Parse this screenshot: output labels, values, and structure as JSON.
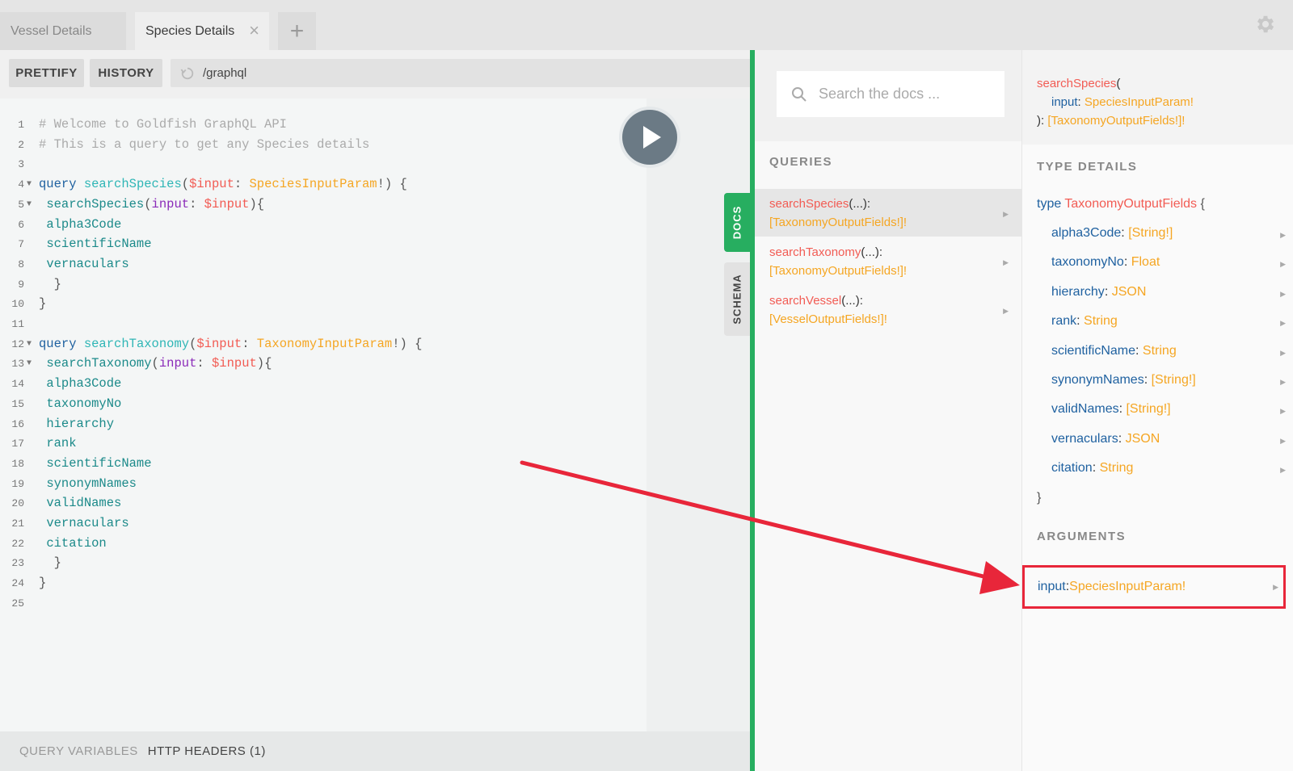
{
  "tabs": [
    {
      "label": "Vessel Details",
      "active": false
    },
    {
      "label": "Species Details",
      "active": true
    }
  ],
  "tab_close_glyph": "×",
  "tab_add_glyph": "+",
  "toolbar": {
    "prettify_label": "PRETTIFY",
    "history_label": "HISTORY",
    "endpoint": "/graphql"
  },
  "editor": {
    "lines": [
      {
        "n": "1",
        "fold": false
      },
      {
        "n": "2",
        "fold": false
      },
      {
        "n": "3",
        "fold": false
      },
      {
        "n": "4",
        "fold": true
      },
      {
        "n": "5",
        "fold": true
      },
      {
        "n": "6",
        "fold": false
      },
      {
        "n": "7",
        "fold": false
      },
      {
        "n": "8",
        "fold": false
      },
      {
        "n": "9",
        "fold": false
      },
      {
        "n": "10",
        "fold": false
      },
      {
        "n": "11",
        "fold": false
      },
      {
        "n": "12",
        "fold": true
      },
      {
        "n": "13",
        "fold": true
      },
      {
        "n": "14",
        "fold": false
      },
      {
        "n": "15",
        "fold": false
      },
      {
        "n": "16",
        "fold": false
      },
      {
        "n": "17",
        "fold": false
      },
      {
        "n": "18",
        "fold": false
      },
      {
        "n": "19",
        "fold": false
      },
      {
        "n": "20",
        "fold": false
      },
      {
        "n": "21",
        "fold": false
      },
      {
        "n": "22",
        "fold": false
      },
      {
        "n": "23",
        "fold": false
      },
      {
        "n": "24",
        "fold": false
      },
      {
        "n": "25",
        "fold": false
      }
    ],
    "comment1": "# Welcome to Goldfish GraphQL API",
    "comment2": "# This is a query to get any Species details",
    "kw_query": "query",
    "op1_name": "searchSpecies",
    "op1_var": "$input",
    "op1_type": "SpeciesInputParam",
    "op1_field": "searchSpecies",
    "op1_arg": "input",
    "op1_fields": [
      "alpha3Code",
      "scientificName",
      "vernaculars"
    ],
    "op2_name": "searchTaxonomy",
    "op2_var": "$input",
    "op2_type": "TaxonomyInputParam",
    "op2_field": "searchTaxonomy",
    "op2_arg": "input",
    "op2_fields": [
      "alpha3Code",
      "taxonomyNo",
      "hierarchy",
      "rank",
      "scientificName",
      "synonymNames",
      "validNames",
      "vernaculars",
      "citation"
    ]
  },
  "side_tabs": {
    "docs": "DOCS",
    "schema": "SCHEMA"
  },
  "bottom": {
    "query_variables": "QUERY VARIABLES",
    "http_headers": "HTTP HEADERS (1)"
  },
  "docs": {
    "search_placeholder": "Search the docs ...",
    "queries_heading": "QUERIES",
    "queries": [
      {
        "name": "searchSpecies",
        "args": "(...):",
        "type": "[TaxonomyOutputFields!]!",
        "selected": true
      },
      {
        "name": "searchTaxonomy",
        "args": "(...):",
        "type": "[TaxonomyOutputFields!]!",
        "selected": false
      },
      {
        "name": "searchVessel",
        "args": "(...):",
        "type": "[VesselOutputFields!]!",
        "selected": false
      }
    ]
  },
  "details": {
    "sig_name": "searchSpecies",
    "sig_open": "(",
    "sig_arg": "input",
    "sig_arg_type": "SpeciesInputParam!",
    "sig_close": "):",
    "sig_return": "[TaxonomyOutputFields!]!",
    "type_heading": "TYPE DETAILS",
    "type_kw": "type",
    "type_name": "TaxonomyOutputFields",
    "fields": [
      {
        "name": "alpha3Code",
        "type": "[String!]"
      },
      {
        "name": "taxonomyNo",
        "type": "Float"
      },
      {
        "name": "hierarchy",
        "type": "JSON"
      },
      {
        "name": "rank",
        "type": "String"
      },
      {
        "name": "scientificName",
        "type": "String"
      },
      {
        "name": "synonymNames",
        "type": "[String!]"
      },
      {
        "name": "validNames",
        "type": "[String!]"
      },
      {
        "name": "vernaculars",
        "type": "JSON"
      },
      {
        "name": "citation",
        "type": "String"
      }
    ],
    "args_heading": "ARGUMENTS",
    "arg_name": "input",
    "arg_type": "SpeciesInputParam!"
  },
  "colors": {
    "accent_green": "#27ae60",
    "annotation_red": "#e8263a",
    "name_red": "#f25c54",
    "type_orange": "#f5a623",
    "keyword_blue": "#1f61a0"
  },
  "icons": [
    "gear-icon",
    "refresh-icon",
    "play-icon",
    "search-icon",
    "chevron-right-icon",
    "close-icon",
    "plus-icon"
  ]
}
